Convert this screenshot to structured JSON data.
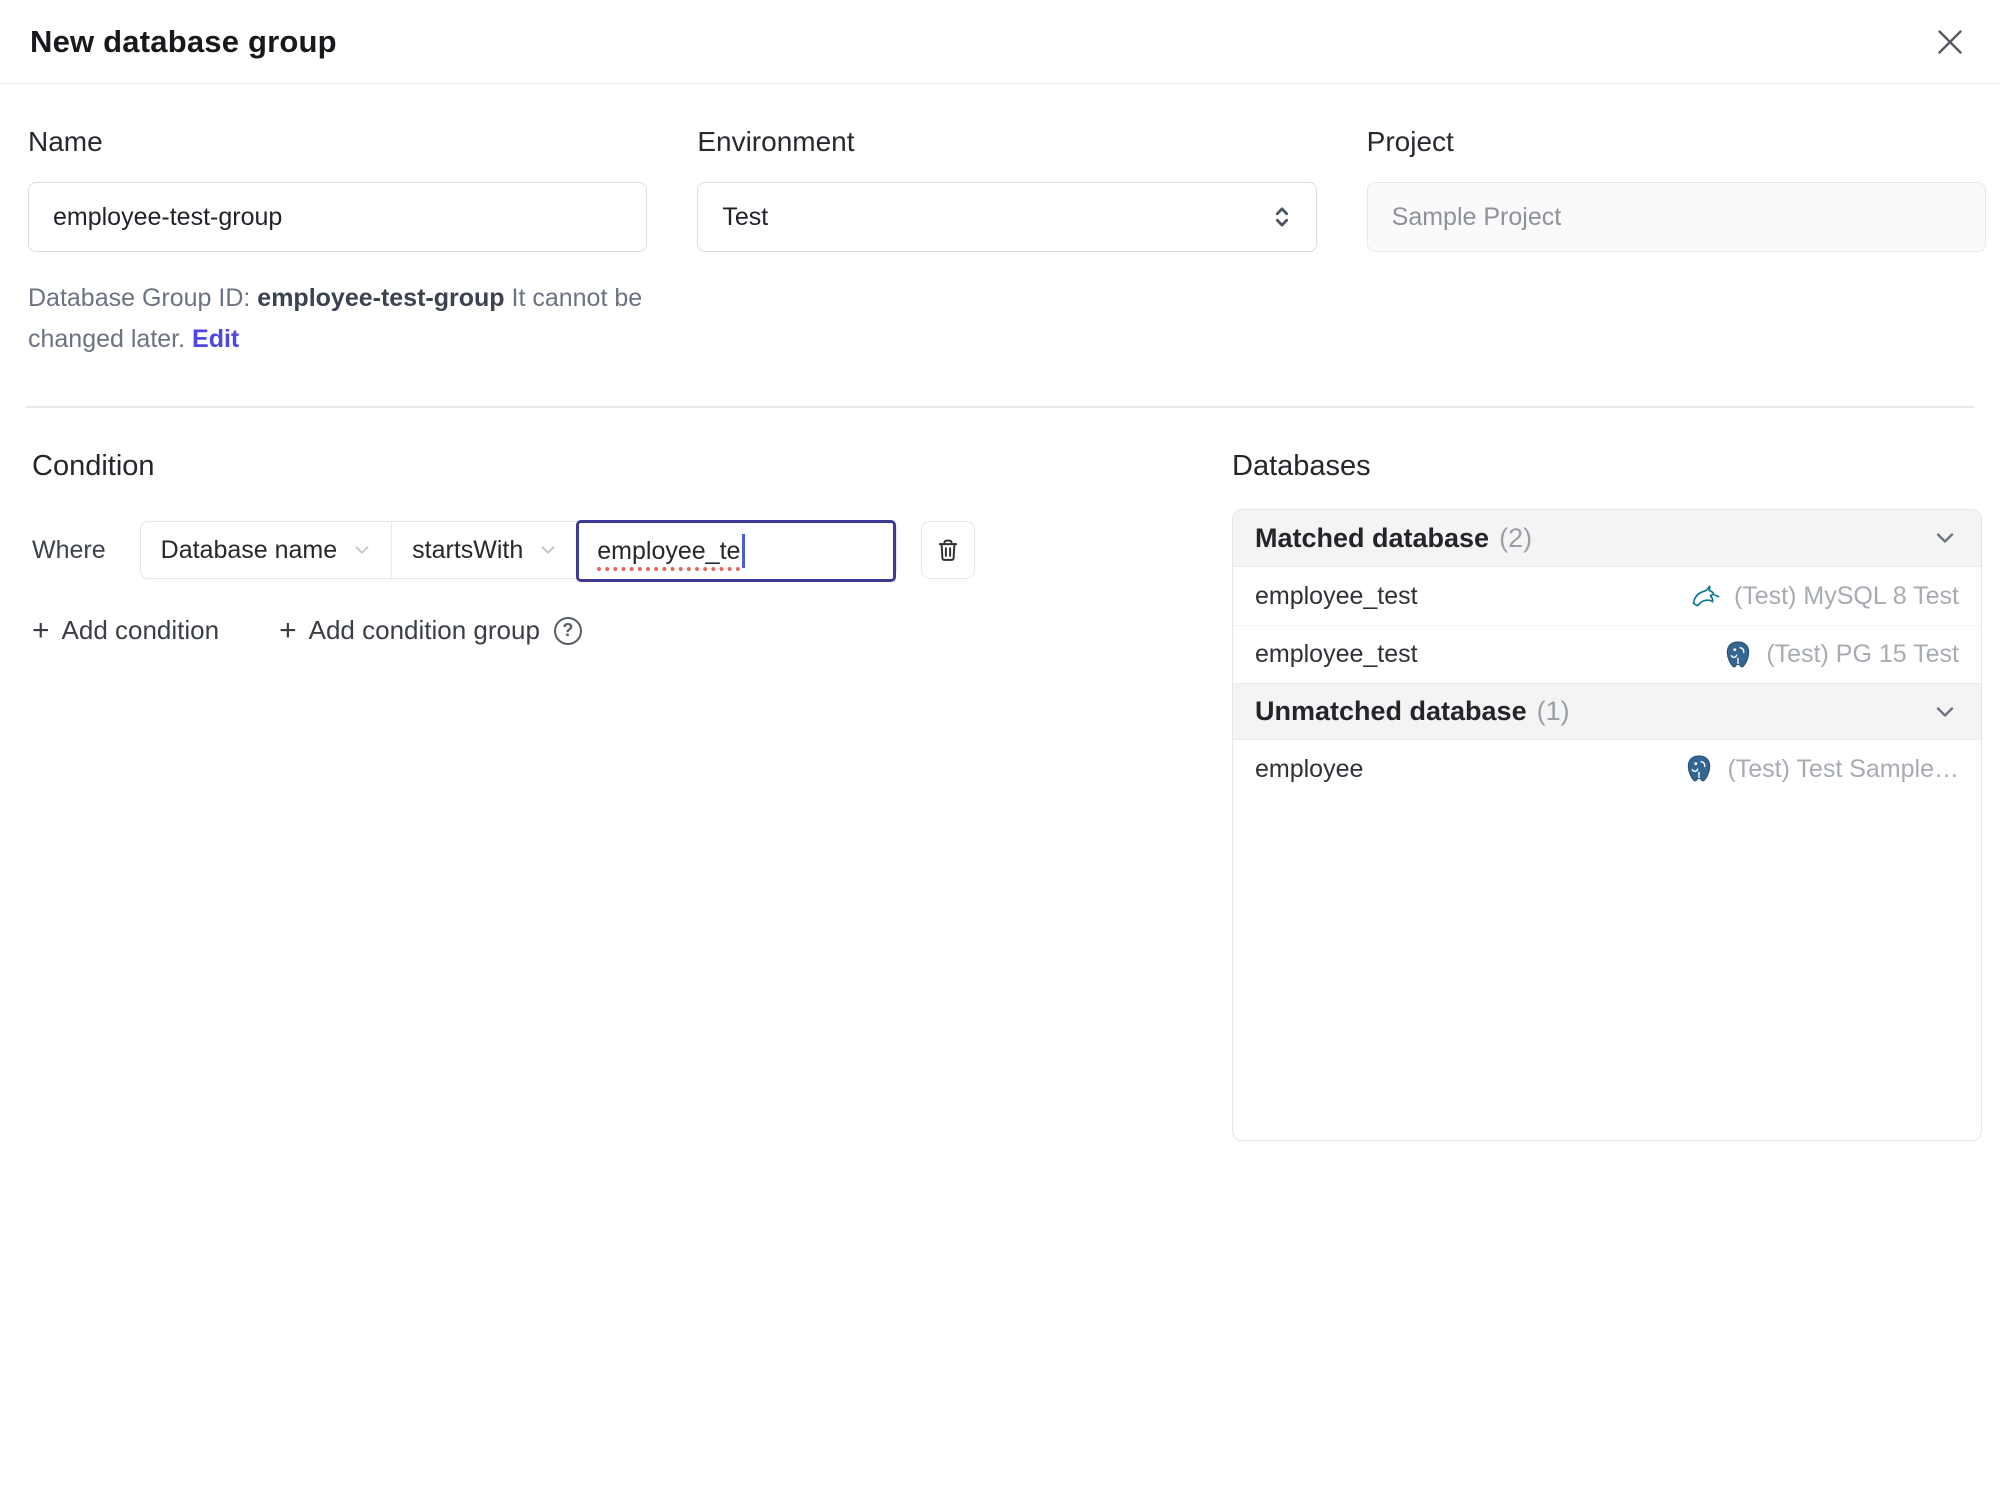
{
  "header": {
    "title": "New database group"
  },
  "form": {
    "name": {
      "label": "Name",
      "value": "employee-test-group"
    },
    "environment": {
      "label": "Environment",
      "value": "Test"
    },
    "project": {
      "label": "Project",
      "value": "Sample Project"
    },
    "group_id_note": {
      "prefix": "Database Group ID: ",
      "id": "employee-test-group",
      "suffix": " It cannot be changed later. ",
      "edit_label": "Edit"
    }
  },
  "condition": {
    "title": "Condition",
    "where_label": "Where",
    "field_selected": "Database name",
    "operator_selected": "startsWith",
    "value": "employee_te",
    "add_condition_label": "Add condition",
    "add_condition_group_label": "Add condition group"
  },
  "databases": {
    "title": "Databases",
    "matched": {
      "label": "Matched database",
      "count": "(2)",
      "rows": [
        {
          "name": "employee_test",
          "engine": "mysql",
          "instance": "(Test) MySQL 8 Test"
        },
        {
          "name": "employee_test",
          "engine": "postgres",
          "instance": "(Test) PG 15 Test"
        }
      ]
    },
    "unmatched": {
      "label": "Unmatched database",
      "count": "(1)",
      "rows": [
        {
          "name": "employee",
          "engine": "postgres",
          "instance": "(Test) Test Sample…"
        }
      ]
    }
  },
  "icons": {
    "plus": "+",
    "help": "?"
  },
  "colors": {
    "accent_link": "#4f46e5",
    "focused_border": "#3f3a96",
    "mysql": "#00758f",
    "postgres": "#336791",
    "section_header_bg": "#f4f4f5"
  }
}
